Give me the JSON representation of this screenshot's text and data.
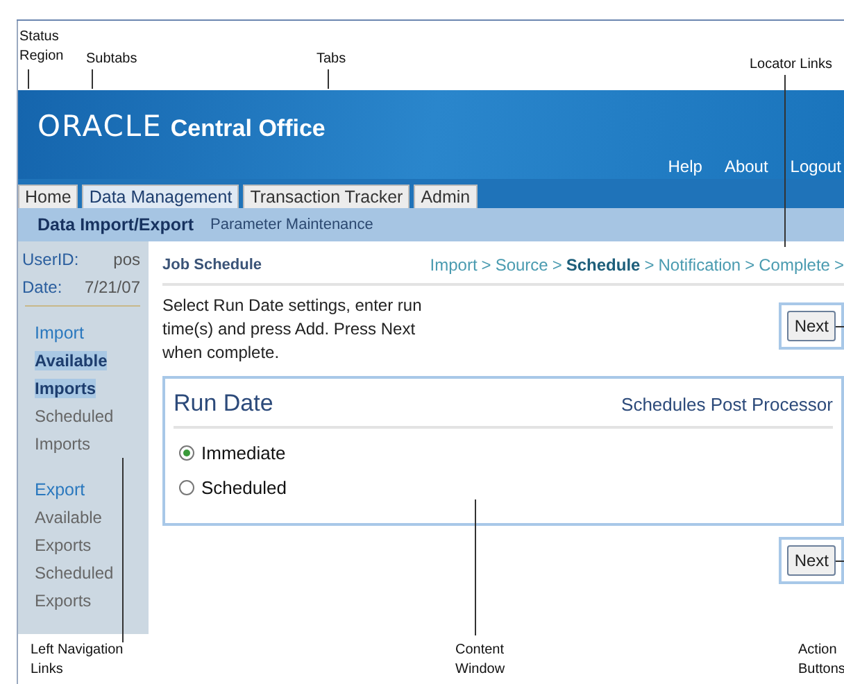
{
  "callouts": [
    {
      "text": "Status Region"
    },
    {
      "text": "Subtabs"
    },
    {
      "text": "Tabs"
    },
    {
      "text": "Locator Links"
    },
    {
      "text": "Left Navigation Links"
    },
    {
      "text": "Content Window"
    },
    {
      "text": "Action Buttons"
    }
  ],
  "header": {
    "logo": "ORACLE",
    "product": "Central Office",
    "links": [
      "Help",
      "About",
      "Logout"
    ]
  },
  "tabs": [
    {
      "label": "Home",
      "selected": false
    },
    {
      "label": "Data Management",
      "selected": true
    },
    {
      "label": "Transaction Tracker",
      "selected": false
    },
    {
      "label": "Admin",
      "selected": false
    }
  ],
  "subtabs": [
    {
      "label": "Data Import/Export",
      "selected": true
    },
    {
      "label": "Parameter Maintenance",
      "selected": false
    }
  ],
  "status": [
    {
      "label": "UserID:",
      "value": "pos"
    },
    {
      "label": "Date:",
      "value": "7/21/07"
    }
  ],
  "nav": [
    {
      "heading": "Import",
      "items": [
        {
          "label": "Available Imports",
          "selected": true
        },
        {
          "label": "Scheduled Imports",
          "selected": false
        }
      ]
    },
    {
      "heading": "Export",
      "items": [
        {
          "label": "Available Exports",
          "selected": false
        },
        {
          "label": "Scheduled Exports",
          "selected": false
        }
      ]
    }
  ],
  "page": {
    "title": "Job Schedule",
    "locator": [
      {
        "label": "Import",
        "current": false
      },
      {
        "label": "Source",
        "current": false
      },
      {
        "label": "Schedule",
        "current": true
      },
      {
        "label": "Notification",
        "current": false
      },
      {
        "label": "Complete",
        "current": false
      }
    ],
    "separator": ">",
    "instructions": "Select Run Date settings, enter run time(s) and press Add. Press Next when complete.",
    "next_top": "Next",
    "next_bottom": "Next"
  },
  "panel": {
    "title": "Run Date",
    "link": "Schedules Post Processor",
    "options": [
      {
        "label": "Immediate",
        "selected": true
      },
      {
        "label": "Scheduled",
        "selected": false
      }
    ]
  }
}
